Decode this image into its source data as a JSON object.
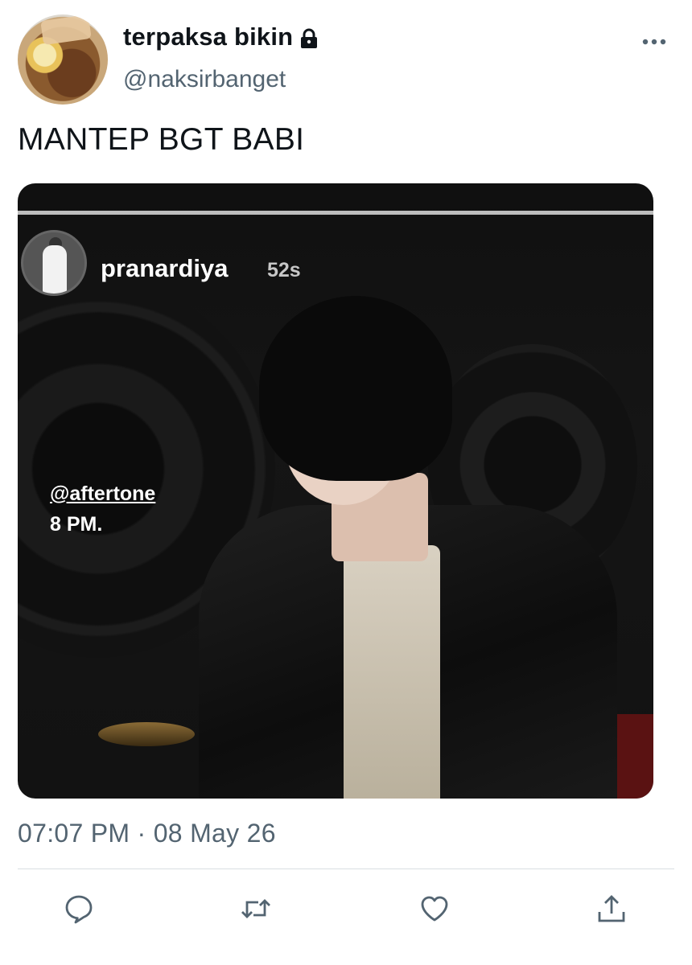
{
  "tweet": {
    "author": {
      "display_name": "terpaksa bikin",
      "handle": "@naksirbanget",
      "avatar_icon": "food-plate-avatar",
      "protected_icon": "lock-icon"
    },
    "text": "MANTEP BGT BABI",
    "media": {
      "story_username": "pranardiya",
      "story_age": "52s",
      "mention": "@aftertone",
      "caption": "8 PM."
    },
    "timestamp": "07:07 PM · 08 May 26",
    "actions": [
      {
        "name": "reply",
        "icon": "reply-icon"
      },
      {
        "name": "retweet",
        "icon": "retweet-icon"
      },
      {
        "name": "like",
        "icon": "heart-icon"
      },
      {
        "name": "share",
        "icon": "share-icon"
      }
    ]
  },
  "colors": {
    "text_primary": "#0f1419",
    "text_secondary": "#536471",
    "divider": "#d9dee2"
  }
}
